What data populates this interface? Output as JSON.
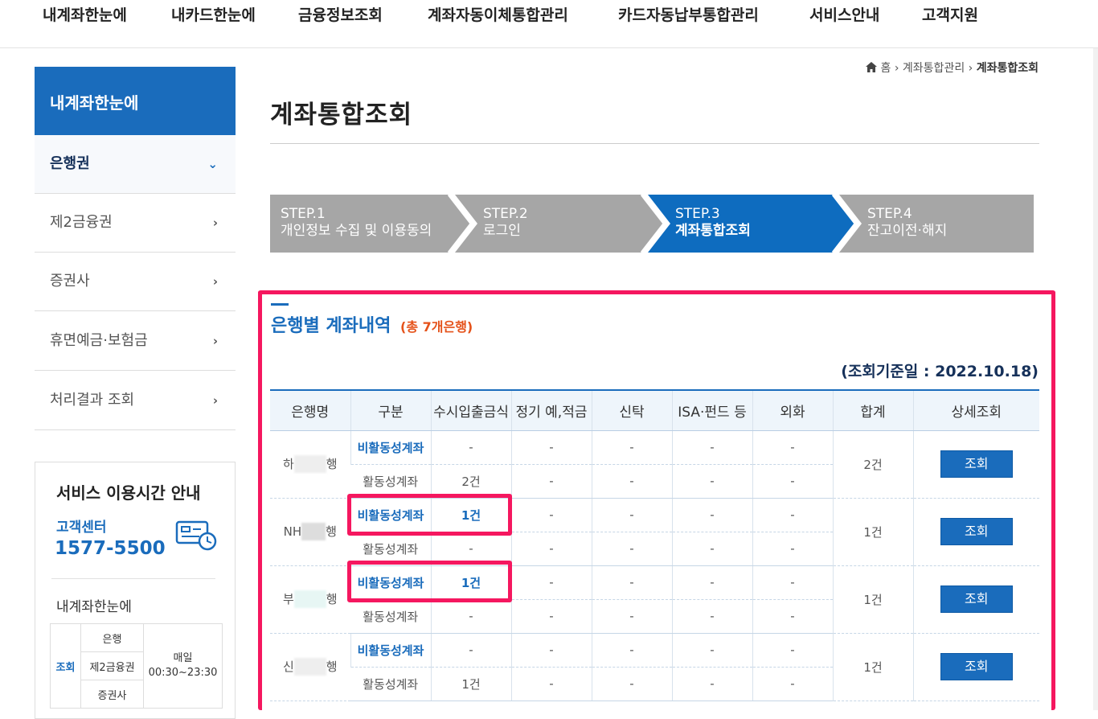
{
  "topnav": [
    "내계좌한눈에",
    "내카드한눈에",
    "금융정보조회",
    "계좌자동이체통합관리",
    "카드자동납부통합관리",
    "서비스안내",
    "고객지원"
  ],
  "sidebar": {
    "title": "내계좌한눈에",
    "items": [
      {
        "label": "은행권",
        "chevron": "⌄"
      },
      {
        "label": "제2금융권",
        "chevron": "›"
      },
      {
        "label": "증권사",
        "chevron": "›"
      },
      {
        "label": "휴면예금·보험금",
        "chevron": "›"
      },
      {
        "label": "처리결과 조회",
        "chevron": "›"
      }
    ]
  },
  "service": {
    "title": "서비스 이용시간 안내",
    "center_label": "고객센터",
    "phone": "1577-5500",
    "sub_title": "내계좌한눈에",
    "table": {
      "head": "조회",
      "rows": [
        "은행",
        "제2금융권",
        "증권사"
      ],
      "time_1": "매일",
      "time_2": "00:30~23:30"
    }
  },
  "breadcrumb": {
    "home": "홈",
    "mid": "계좌통합관리",
    "current": "계좌통합조회"
  },
  "page_title": "계좌통합조회",
  "steps": [
    {
      "label": "STEP.1",
      "text": "개인정보 수집 및 이용동의"
    },
    {
      "label": "STEP.2",
      "text": "로그인"
    },
    {
      "label": "STEP.3",
      "text": "계좌통합조회"
    },
    {
      "label": "STEP.4",
      "text": "잔고이전·해지"
    }
  ],
  "section": {
    "title": "은행별 계좌내역",
    "total": "(총 7개은행)",
    "ref_date": "(조회기준일 : 2022.10.18)"
  },
  "table": {
    "headers": [
      "은행명",
      "구분",
      "수시입출금식",
      "정기 예,적금",
      "신탁",
      "ISA·펀드 등",
      "외화",
      "합계",
      "상세조회"
    ],
    "button_label": "조회",
    "banks": [
      {
        "name_pre": "하",
        "name_post": "행",
        "total": "2건",
        "rows": [
          [
            "비활동성계좌",
            "-",
            "-",
            "-",
            "-",
            "-"
          ],
          [
            "활동성계좌",
            "2건",
            "-",
            "-",
            "-",
            "-"
          ]
        ]
      },
      {
        "name_pre": "NH",
        "name_post": "행",
        "total": "1건",
        "rows": [
          [
            "비활동성계좌",
            "1건",
            "-",
            "-",
            "-",
            "-"
          ],
          [
            "활동성계좌",
            "-",
            "-",
            "-",
            "-",
            "-"
          ]
        ]
      },
      {
        "name_pre": "부",
        "name_post": "행",
        "total": "1건",
        "rows": [
          [
            "비활동성계좌",
            "1건",
            "-",
            "-",
            "-",
            "-"
          ],
          [
            "활동성계좌",
            "-",
            "-",
            "-",
            "-",
            "-"
          ]
        ]
      },
      {
        "name_pre": "신",
        "name_post": "행",
        "total": "1건",
        "rows": [
          [
            "비활동성계좌",
            "-",
            "-",
            "-",
            "-",
            "-"
          ],
          [
            "활동성계좌",
            "1건",
            "-",
            "-",
            "-",
            "-"
          ]
        ]
      }
    ]
  },
  "colors": {
    "primary": "#1a6cbc",
    "highlight": "#f5175f",
    "step_inactive": "#a6a6a6",
    "step_active": "#0e6cbf"
  }
}
